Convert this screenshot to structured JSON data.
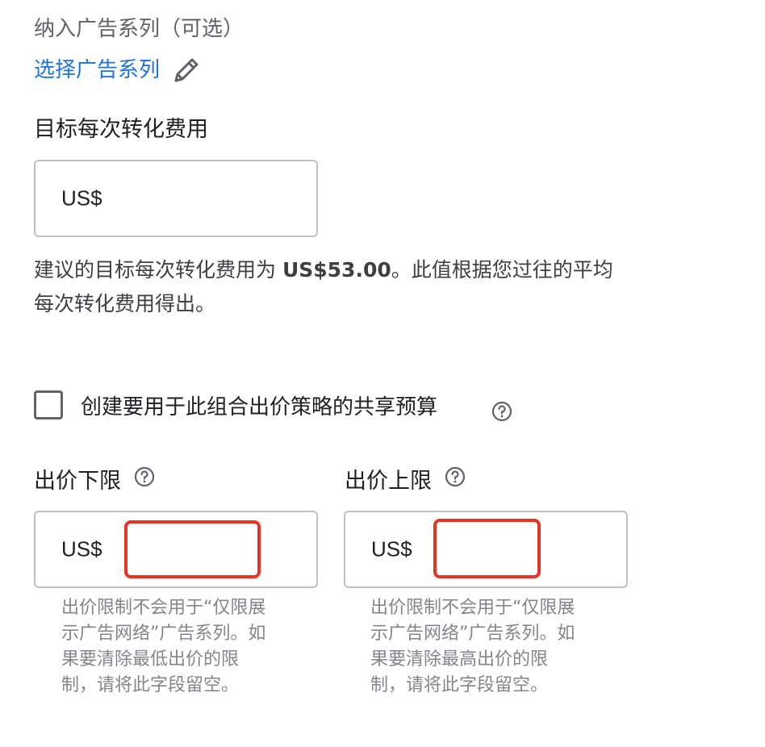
{
  "campaigns": {
    "label": "纳入广告系列（可选）",
    "select_link": "选择广告系列",
    "edit_icon": "pencil-icon"
  },
  "target_cpa": {
    "title": "目标每次转化费用",
    "currency": "US$",
    "value": "",
    "suggestion_prefix": "建议的目标每次转化费用为 ",
    "suggestion_amount": "US$53.00",
    "suggestion_suffix": "。此值根据您过往的平均",
    "suggestion_line2": "每次转化费用得出。"
  },
  "shared_budget": {
    "checked": false,
    "label": "创建要用于此组合出价策略的共享预算",
    "help_icon": "help-circle-icon"
  },
  "bid_floor": {
    "title": "出价下限",
    "currency": "US$",
    "value": "",
    "note_lines": [
      "出价限制不会用于“仅限展",
      "示广告网络”广告系列。如",
      "果要清除最低出价的限",
      "制，请将此字段留空。"
    ]
  },
  "bid_ceiling": {
    "title": "出价上限",
    "currency": "US$",
    "value": "",
    "note_lines": [
      "出价限制不会用于“仅限展",
      "示广告网络”广告系列。如",
      "果要清除最高出价的限",
      "制，请将此字段留空。"
    ]
  },
  "colors": {
    "link": "#1a73e8",
    "highlight": "#ea3323",
    "border": "#bdc1c6"
  }
}
